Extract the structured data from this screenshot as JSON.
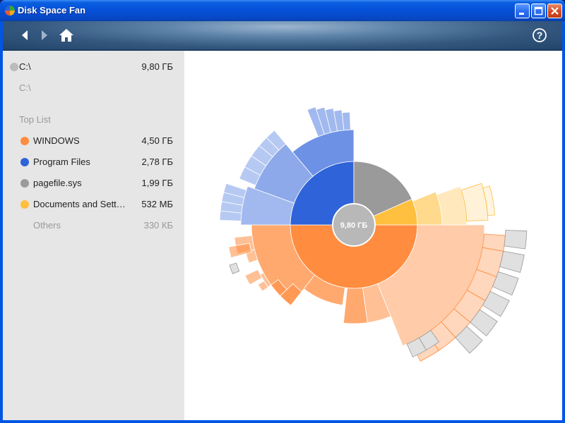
{
  "window": {
    "title": "Disk Space Fan"
  },
  "sidebar": {
    "root": {
      "label": "C:\\",
      "size": "9,80 ГБ",
      "color": "#bbbbbb"
    },
    "path": "C:\\",
    "top_list_label": "Top List",
    "items": [
      {
        "label": "WINDOWS",
        "size": "4,50 ГБ",
        "color": "#ff8c3f"
      },
      {
        "label": "Program Files",
        "size": "2,78 ГБ",
        "color": "#2f63d9"
      },
      {
        "label": "pagefile.sys",
        "size": "1,99 ГБ",
        "color": "#9a9a9a"
      },
      {
        "label": "Documents and Sett…",
        "size": "532 МБ",
        "color": "#ffbf3f"
      }
    ],
    "others": {
      "label": "Others",
      "size": "330 КБ"
    }
  },
  "chart": {
    "center_label": "9,80 ГБ"
  },
  "colors": {
    "windows": "#ff8c3f",
    "program_files": "#2f63d9",
    "pagefile": "#9a9a9a",
    "documents": "#ffbf3f"
  }
}
